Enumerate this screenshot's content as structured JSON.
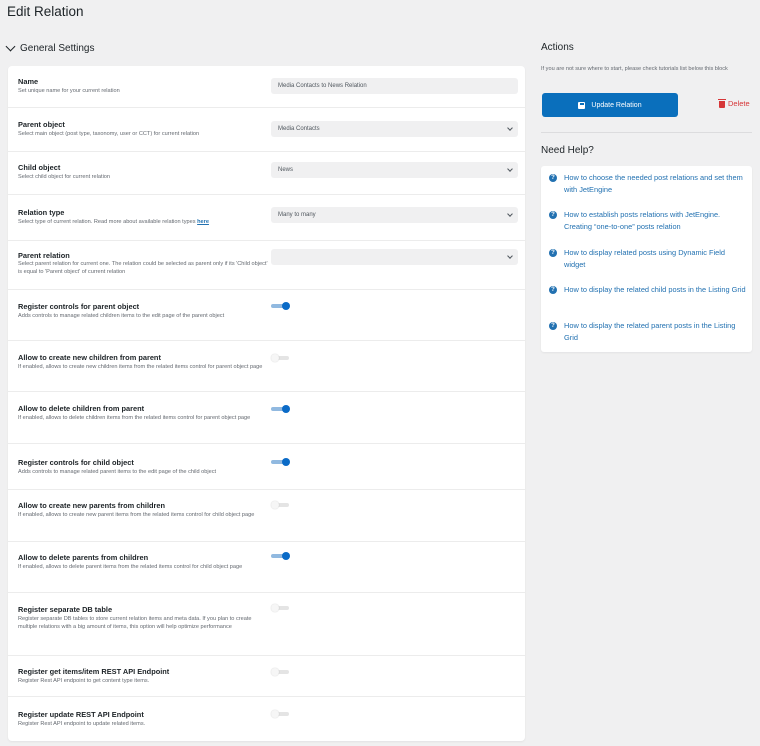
{
  "page": {
    "title": "Edit Relation"
  },
  "section": {
    "label": "General Settings"
  },
  "settings": {
    "name": {
      "label": "Name",
      "desc": "Set unique name for your current relation",
      "value": "Media Contacts to News Relation"
    },
    "parent_object": {
      "label": "Parent object",
      "desc": "Select main object (post type, taxonomy, user or CCT) for current relation",
      "value": "Media Contacts"
    },
    "child_object": {
      "label": "Child object",
      "desc": "Select child object for current relation",
      "value": "News"
    },
    "relation_type": {
      "label": "Relation type",
      "desc": "Select type of current relation. Read more about available relation types",
      "link": "here",
      "value": "Many to many"
    },
    "parent_relation": {
      "label": "Parent relation",
      "desc": "Select parent relation for current one. The relation could be selected as parent only if its 'Child object' is equal to 'Parent object' of current relation",
      "value": ""
    },
    "toggles": [
      {
        "label": "Register controls for parent object",
        "desc": "Adds controls to manage related children items to the edit page of the parent object",
        "on": true
      },
      {
        "label": "Allow to create new children from parent",
        "desc": "If enabled, allows to create new children items from the related items control for parent object page",
        "on": false
      },
      {
        "label": "Allow to delete children from parent",
        "desc": "If enabled, allows to delete children items from the related items control for parent object page",
        "on": true
      },
      {
        "label": "Register controls for child object",
        "desc": "Adds controls to manage related parent items to the edit page of the child object",
        "on": true
      },
      {
        "label": "Allow to create new parents from children",
        "desc": "If enabled, allows to create new parent items from the related items control for child object page",
        "on": false
      },
      {
        "label": "Allow to delete parents from children",
        "desc": "If enabled, allows to delete parent items from the related items control for child object page",
        "on": true
      },
      {
        "label": "Register separate DB table",
        "desc": "Register separate DB tables to store current relation items and meta data. If you plan to create multiple relations with a big amount of items, this option will help optimize performance",
        "on": false
      },
      {
        "label": "Register get items/item REST API Endpoint",
        "desc": "Register Rest API endpoint to get content type items.",
        "on": false
      },
      {
        "label": "Register update REST API Endpoint",
        "desc": "Register Rest API endpoint to update related items.",
        "on": false
      }
    ]
  },
  "actions": {
    "title": "Actions",
    "hint": "If you are not sure where to start, please check tutorials list below this block",
    "update_label": "Update Relation",
    "delete_label": "Delete"
  },
  "help": {
    "title": "Need Help?",
    "items": [
      "How to choose the needed post relations and set them with JetEngine",
      "How to establish posts relations with JetEngine. Creating “one-to-one” posts relation",
      "How to display related posts using Dynamic Field widget",
      "How to display the related child posts in the Listing Grid",
      "How to display the related parent posts in the Listing Grid"
    ]
  },
  "icons": {
    "section_toggle": "chevron-down-icon",
    "dropdown": "chevron-down-icon",
    "update": "save-icon",
    "delete": "trash-icon",
    "help_item": "question-circle-icon"
  },
  "colors": {
    "accent": "#0a6fbc",
    "link": "#2271b1",
    "danger": "#d63638",
    "toggle_on": "#0b6bc7"
  }
}
